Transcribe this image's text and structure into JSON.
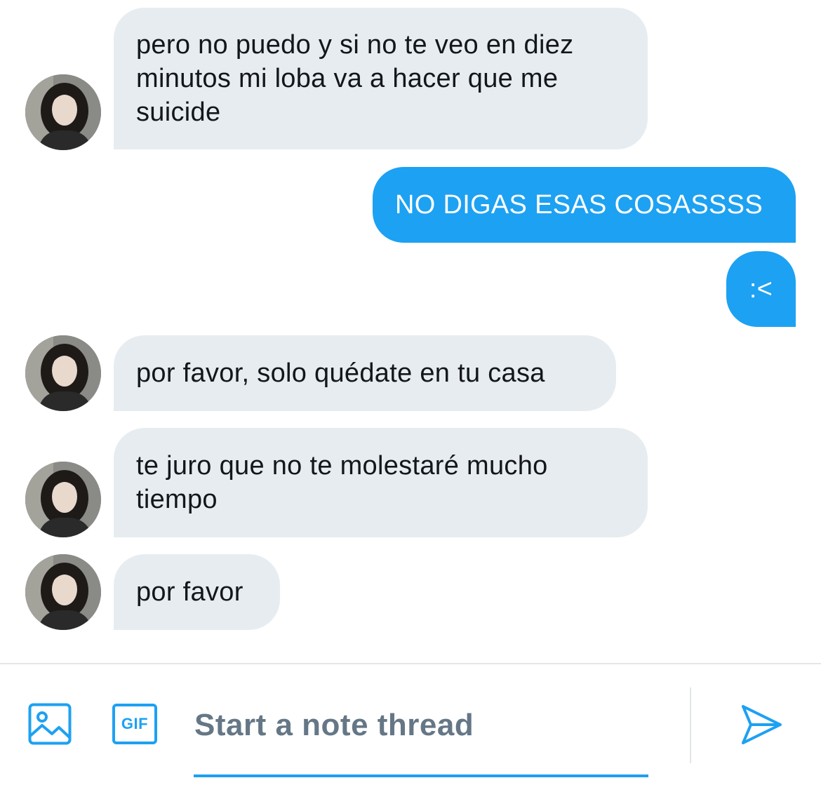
{
  "messages": [
    {
      "direction": "incoming",
      "text": "pero no puedo y si no te veo en diez minutos mi loba va a hacer que me suicide",
      "lines": [
        "pero no puedo y si no te veo en diez",
        "minutos mi loba va a hacer que me",
        "suicide"
      ]
    },
    {
      "direction": "outgoing",
      "text": "NO DIGAS ESAS COSASSSS"
    },
    {
      "direction": "outgoing",
      "text": ":<"
    },
    {
      "direction": "incoming",
      "text": "por favor, solo quédate en tu casa"
    },
    {
      "direction": "incoming",
      "text": "te juro que no te molestaré mucho tiempo",
      "lines": [
        "te juro que no te molestaré mucho",
        "tiempo"
      ]
    },
    {
      "direction": "incoming",
      "text": "por favor"
    }
  ],
  "composer": {
    "placeholder": "Start a note thread",
    "image_icon": "image-icon",
    "gif_icon": "gif-icon",
    "gif_label": "GIF",
    "send_icon": "send-icon"
  },
  "colors": {
    "incoming_bubble": "#e7ecf0",
    "outgoing_bubble": "#1da1f2",
    "accent": "#1da1f2",
    "placeholder_text": "#657786"
  }
}
